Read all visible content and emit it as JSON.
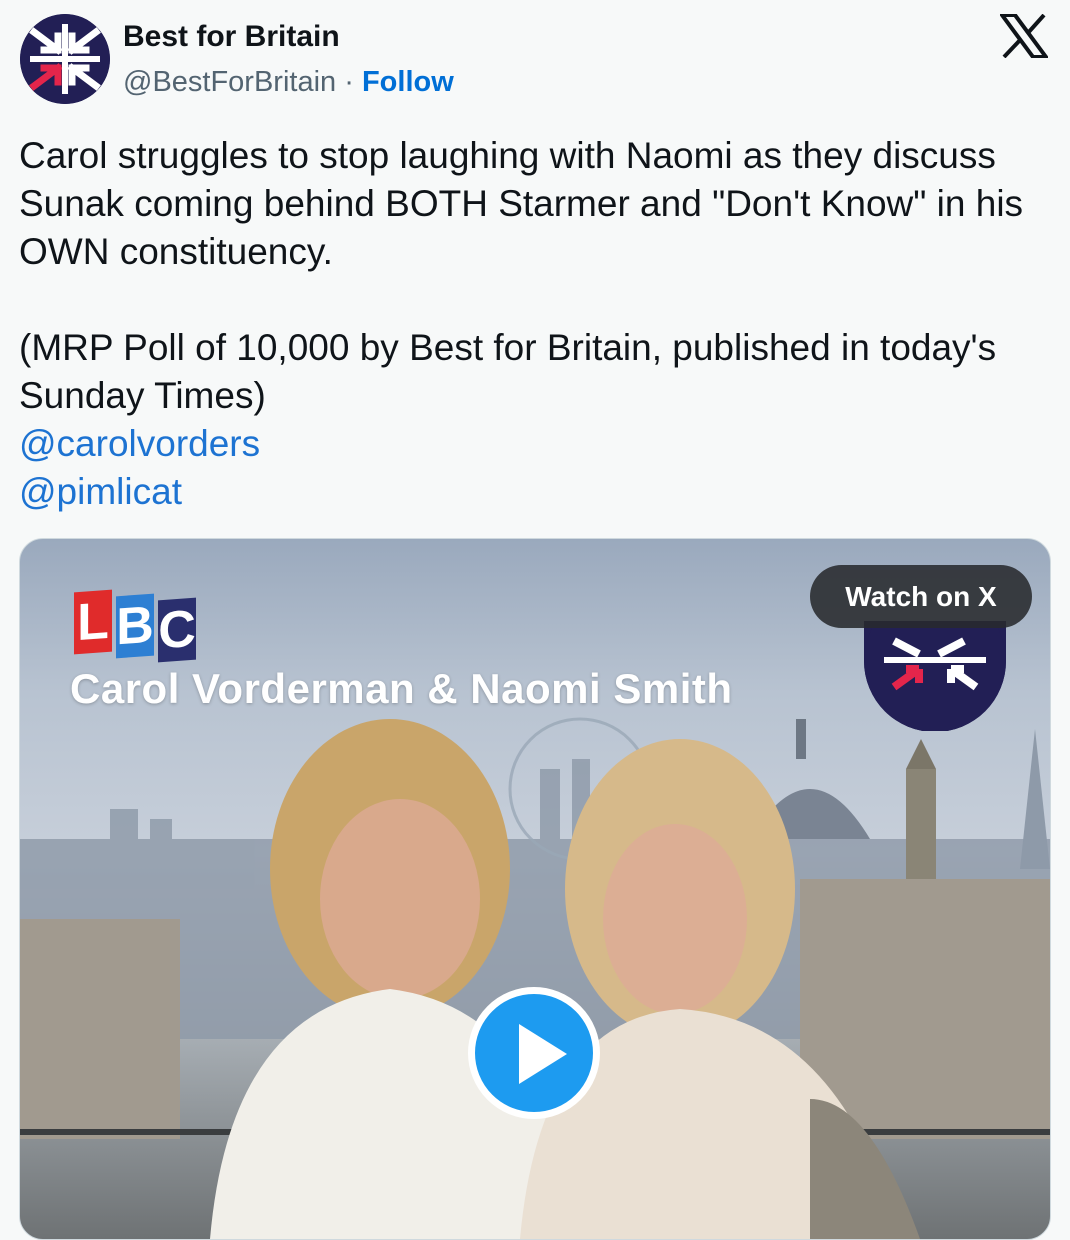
{
  "account": {
    "name": "Best for Britain",
    "handle": "@BestForBritain",
    "separator": " · ",
    "follow_label": "Follow"
  },
  "icons": {
    "avatar": "best-for-britain-logo",
    "close": "x-logo-icon",
    "play": "play-icon"
  },
  "tweet": {
    "paragraph1": "Carol struggles to stop laughing with Naomi as they discuss Sunak coming behind BOTH Starmer and \"Don't Know\" in his OWN constituency.",
    "paragraph2": "(MRP Poll of 10,000 by Best for Britain, published in today's Sunday Times)",
    "mentions": [
      "@carolvorders",
      "@pimlicat"
    ]
  },
  "media": {
    "lbc_letters": [
      "L",
      "B",
      "C"
    ],
    "overlay_title": "Carol Vorderman & Naomi Smith",
    "watch_label": "Watch on X"
  },
  "colors": {
    "background": "#f7f9f9",
    "follow": "#006fd6",
    "mention": "#1d73d2",
    "play_button": "#1d9bf0",
    "logo_navy": "#221f55",
    "logo_red": "#e4254b"
  }
}
